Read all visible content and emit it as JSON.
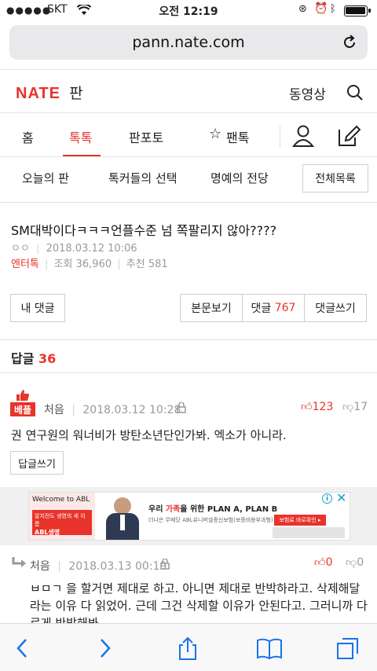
{
  "status": {
    "carrier": "SKT",
    "time": "오전 12:19"
  },
  "address": {
    "url": "pann.nate.com"
  },
  "site": {
    "logo": "NATE",
    "section": "판",
    "video": "동영상"
  },
  "tabs": [
    {
      "label": "홈"
    },
    {
      "label": "톡톡",
      "active": true
    },
    {
      "label": "판포토"
    },
    {
      "label": "팬톡"
    }
  ],
  "subnav": {
    "items": [
      "오늘의 판",
      "톡커들의 선택",
      "명예의 전당"
    ],
    "all_label": "전체목록"
  },
  "post": {
    "title": "SM대박이다ㅋㅋㅋ언플수준 넘 쪽팔리지 않아????",
    "author": "ㅇㅇ",
    "date": "2018.03.12 10:06",
    "category": "엔터톡",
    "views_label": "조회",
    "views": "36,960",
    "recommend_label": "추천",
    "recommend": "581"
  },
  "actions": {
    "my_comments": "내 댓글",
    "view_body": "본문보기",
    "comments_label": "댓글",
    "comments_count": "767",
    "write_comment": "댓글쓰기"
  },
  "replies": {
    "label": "답글",
    "count": "36"
  },
  "comments": [
    {
      "badge": "베플",
      "author": "처음",
      "date": "2018.03.12 10:28",
      "up": "123",
      "down": "17",
      "text": "권 연구원의 워너비가 방탄소년단인가봐. 엑소가 아니라.",
      "reply_label": "답글쓰기"
    },
    {
      "author": "처음",
      "date": "2018.03.13 00:19",
      "up": "0",
      "down": "0",
      "text": "ㅂㅁㄱ 을 할거면 제대로 하고. 아니면 제대로 반박하라고. 삭제해달라는 이유 다 읽었어. 근데 그건 삭제할 이유가 안된다고. 그러니까 다르게 반박해봐."
    }
  ],
  "ad": {
    "welcome": "Welcome to ABL",
    "brand": "ABL생명",
    "promo": "말치전도 생명의 세 이름",
    "headline_pre": "우리 ",
    "headline_red": "가족",
    "headline_post": "을 위한 PLAN A, PLAN B",
    "sub": "더나은 무배당 ABL유니버셜종신보험(보증비용부과형) 1802",
    "cta": "보험료 바로확인 ▸"
  },
  "colors": {
    "accent": "#e8332a",
    "toolbar_icons": "#1a73e8"
  }
}
